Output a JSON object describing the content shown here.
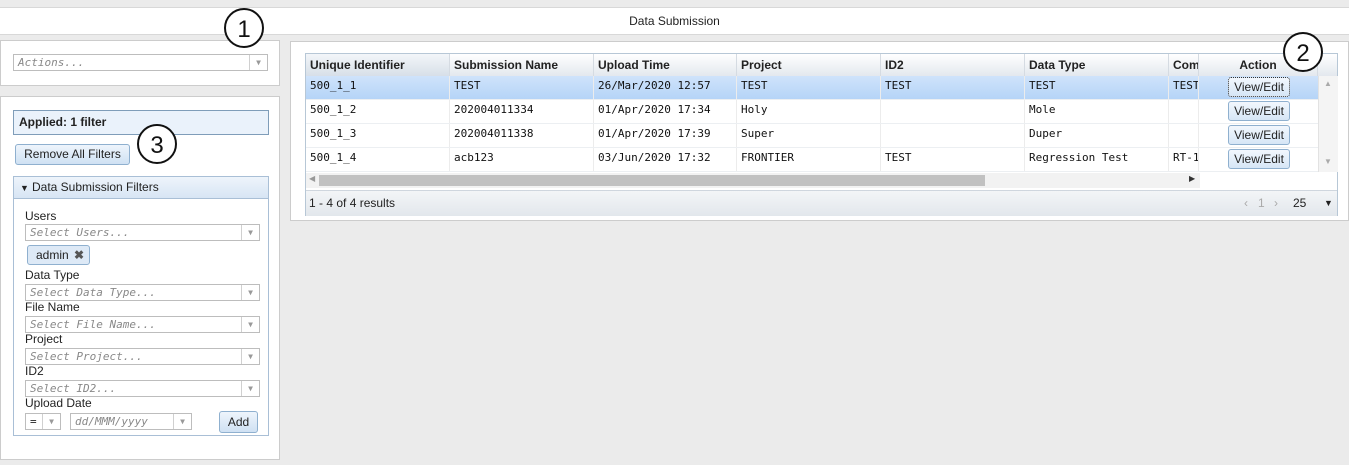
{
  "window": {
    "title": "Data Submission"
  },
  "callouts": [
    "1",
    "2",
    "3"
  ],
  "actions": {
    "placeholder": "Actions..."
  },
  "filters": {
    "applied_label": "Applied: 1 filter",
    "remove_all_label": "Remove All Filters",
    "section_title": "Data Submission Filters",
    "users": {
      "label": "Users",
      "placeholder": "Select Users...",
      "chip": "admin"
    },
    "data_type": {
      "label": "Data Type",
      "placeholder": "Select Data Type..."
    },
    "file_name": {
      "label": "File Name",
      "placeholder": "Select File Name..."
    },
    "project": {
      "label": "Project",
      "placeholder": "Select Project..."
    },
    "id2": {
      "label": "ID2",
      "placeholder": "Select ID2..."
    },
    "upload_date": {
      "label": "Upload Date",
      "operator": "=",
      "placeholder": "dd/MMM/yyyy",
      "add_label": "Add"
    }
  },
  "grid": {
    "columns": [
      "Unique Identifier",
      "Submission Name",
      "Upload Time",
      "Project",
      "ID2",
      "Data Type",
      "Com",
      "Action"
    ],
    "rows": [
      {
        "id": "500_1_1",
        "name": "TEST",
        "time": "26/Mar/2020 12:57",
        "project": "TEST",
        "id2": "TEST",
        "type": "TEST",
        "com": "TEST",
        "action": "View/Edit"
      },
      {
        "id": "500_1_2",
        "name": "202004011334",
        "time": "01/Apr/2020 17:34",
        "project": "Holy",
        "id2": "",
        "type": "Mole",
        "com": "",
        "action": "View/Edit"
      },
      {
        "id": "500_1_3",
        "name": "202004011338",
        "time": "01/Apr/2020 17:39",
        "project": "Super",
        "id2": "",
        "type": "Duper",
        "com": "",
        "action": "View/Edit"
      },
      {
        "id": "500_1_4",
        "name": "acb123",
        "time": "03/Jun/2020 17:32",
        "project": "FRONTIER",
        "id2": "TEST",
        "type": "Regression Test",
        "com": "RT-1",
        "action": "View/Edit"
      }
    ],
    "results_text": "1 - 4 of 4 results",
    "page_number": "1",
    "page_size": "25"
  }
}
